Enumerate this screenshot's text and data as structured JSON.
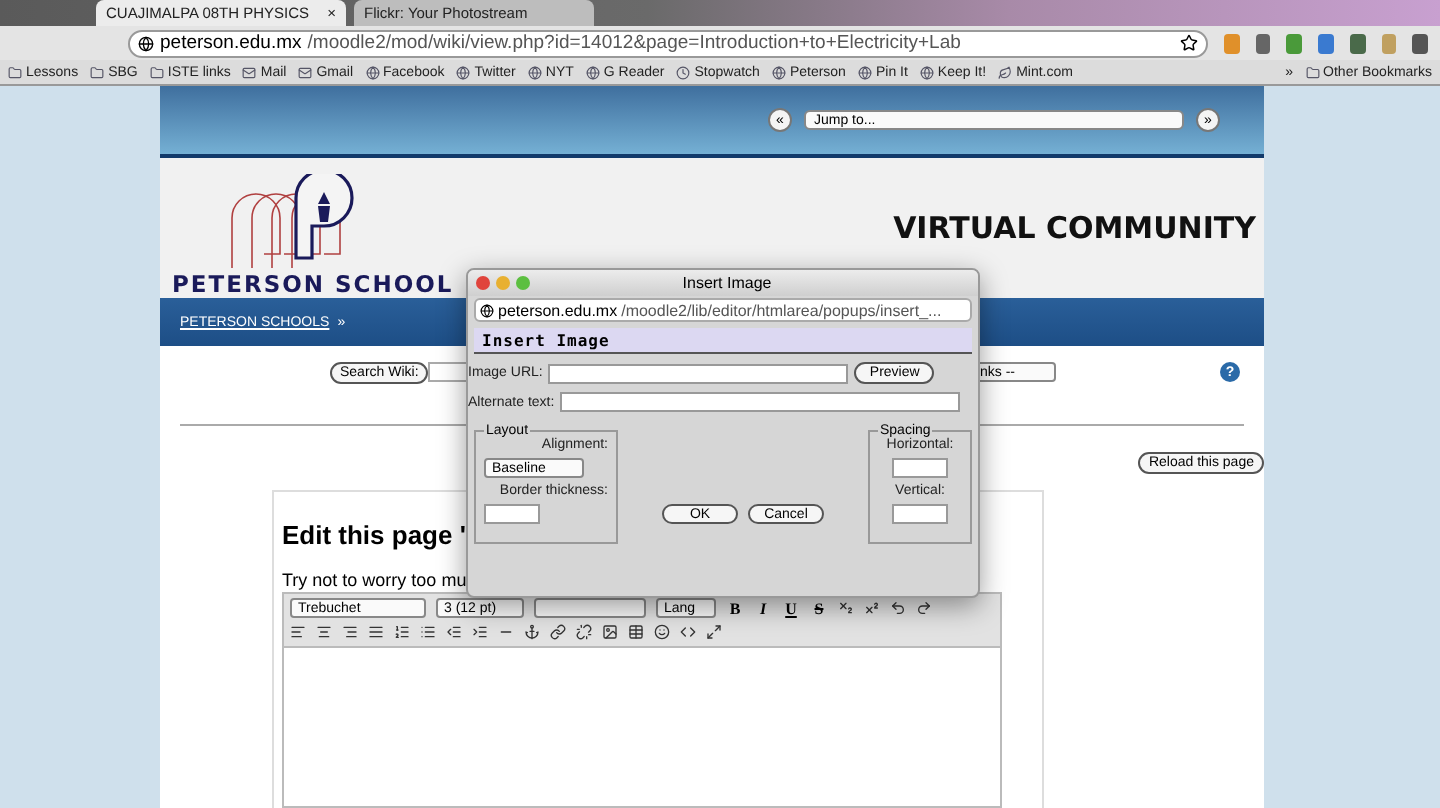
{
  "browser": {
    "tabs": [
      {
        "label": "CUAJIMALPA 08TH PHYSICS",
        "selected": true,
        "close": "×"
      },
      {
        "label": "Flickr: Your Photostream",
        "selected": false
      }
    ],
    "address": {
      "host": "peterson.edu.mx",
      "path": "/moodle2/mod/wiki/view.php?id=14012&page=Introduction+to+Electricity+Lab"
    },
    "bookmarks": [
      "Lessons",
      "SBG",
      "ISTE links",
      "Mail",
      "Gmail",
      "Facebook",
      "Twitter",
      "NYT",
      "G Reader",
      "Stopwatch",
      "Peterson",
      "Pin It",
      "Keep It!",
      "Mint.com"
    ],
    "bookmarks_more": "»",
    "other_bookmarks": "Other Bookmarks"
  },
  "header": {
    "prev": "«",
    "jump": "Jump to...",
    "next": "»",
    "logo_text": "PETERSON SCHOOL",
    "site_title": "VIRTUAL COMMUNITY",
    "breadcrumb": "PETERSON SCHOOLS",
    "breadcrumb_sep": "»"
  },
  "search": {
    "button": "Search Wiki:",
    "links_select": "nks --",
    "help": "?"
  },
  "reload": "Reload this page",
  "editor": {
    "heading": "Edit this page '",
    "hint": "Try not to worry too mu",
    "font": "Trebuchet",
    "size": "3 (12 pt)",
    "lang": "Lang",
    "format_buttons": [
      "B",
      "I",
      "U",
      "S"
    ]
  },
  "dialog": {
    "title": "Insert Image",
    "url_host": "peterson.edu.mx",
    "url_path": "/moodle2/lib/editor/htmlarea/popups/insert_...",
    "heading": "Insert Image",
    "image_url_label": "Image URL:",
    "preview": "Preview",
    "alt_label": "Alternate text:",
    "layout": {
      "legend": "Layout",
      "alignment_label": "Alignment:",
      "alignment": "Baseline",
      "border_label": "Border thickness:"
    },
    "spacing": {
      "legend": "Spacing",
      "horizontal_label": "Horizontal:",
      "vertical_label": "Vertical:"
    },
    "ok": "OK",
    "cancel": "Cancel"
  }
}
